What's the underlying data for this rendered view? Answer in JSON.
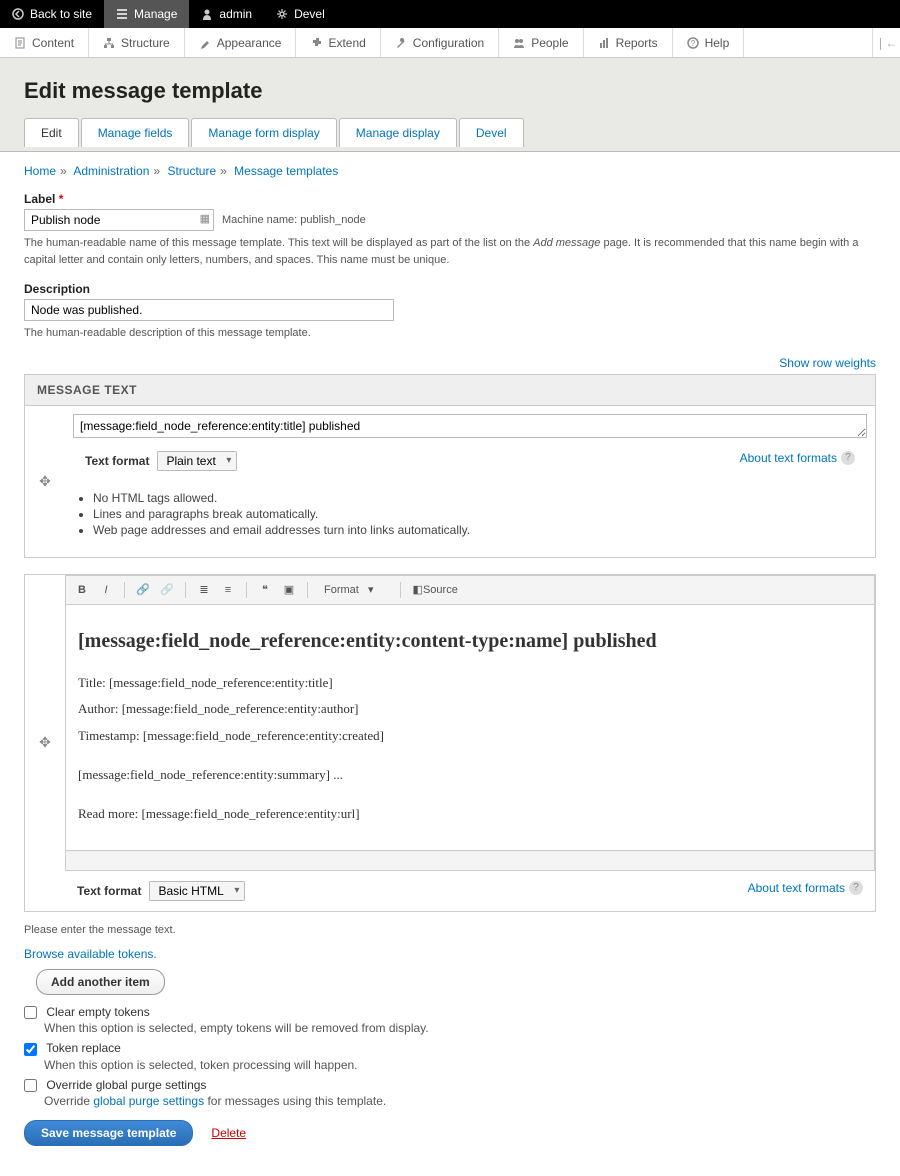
{
  "topbar": {
    "back": "Back to site",
    "manage": "Manage",
    "admin": "admin",
    "devel": "Devel"
  },
  "adminbar": {
    "content": "Content",
    "structure": "Structure",
    "appearance": "Appearance",
    "extend": "Extend",
    "configuration": "Configuration",
    "people": "People",
    "reports": "Reports",
    "help": "Help"
  },
  "page": {
    "title": "Edit message template"
  },
  "tabs": {
    "edit": "Edit",
    "manage_fields": "Manage fields",
    "manage_form": "Manage form display",
    "manage_display": "Manage display",
    "devel": "Devel"
  },
  "breadcrumb": {
    "home": "Home",
    "admin": "Administration",
    "structure": "Structure",
    "templates": "Message templates"
  },
  "label": {
    "label": "Label",
    "value": "Publish node",
    "machine_prefix": "Machine name:",
    "machine_value": "publish_node",
    "help_1": "The human-readable name of this message template. This text will be displayed as part of the list on the ",
    "help_em": "Add message",
    "help_2": " page. It is recommended that this name begin with a capital letter and contain only letters, numbers, and spaces. This name must be unique."
  },
  "description": {
    "label": "Description",
    "value": "Node was published.",
    "help": "The human-readable description of this message template."
  },
  "weights_link": "Show row weights",
  "section_header": "MESSAGE TEXT",
  "textformat_label": "Text format",
  "about_link": "About text formats",
  "partial1": {
    "value": "[message:field_node_reference:entity:title] published",
    "format": "Plain text",
    "tip1": "No HTML tags allowed.",
    "tip2": "Lines and paragraphs break automatically.",
    "tip3": "Web page addresses and email addresses turn into links automatically."
  },
  "cke": {
    "format_label": "Format",
    "source_label": "Source",
    "heading": "[message:field_node_reference:entity:content-type:name] published",
    "p1": "Title: [message:field_node_reference:entity:title]",
    "p2": "Author: [message:field_node_reference:entity:author]",
    "p3": "Timestamp: [message:field_node_reference:entity:created]",
    "p4": "[message:field_node_reference:entity:summary] ...",
    "p5": "Read more: [message:field_node_reference:entity:url]"
  },
  "partial2": {
    "format": "Basic HTML"
  },
  "below": {
    "help": "Please enter the message text.",
    "browse_tokens": "Browse available tokens.",
    "add_item": "Add another item"
  },
  "opts": {
    "clear_label": "Clear empty tokens",
    "clear_desc": "When this option is selected, empty tokens will be removed from display.",
    "replace_label": "Token replace",
    "replace_desc": "When this option is selected, token processing will happen.",
    "override_label": "Override global purge settings",
    "override_desc_1": "Override ",
    "override_link": "global purge settings",
    "override_desc_2": " for messages using this template."
  },
  "actions": {
    "save": "Save message template",
    "delete": "Delete"
  }
}
